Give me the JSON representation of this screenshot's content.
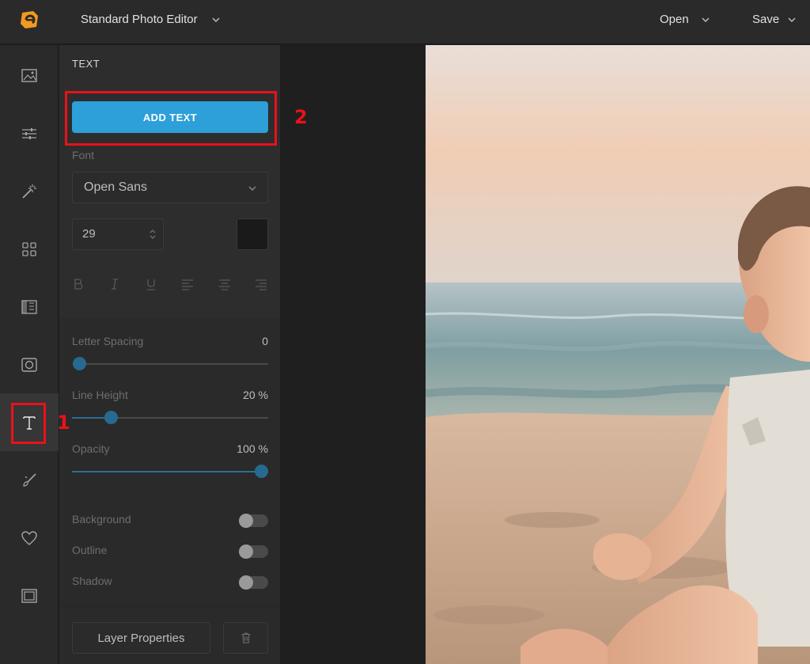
{
  "header": {
    "app_title": "Standard Photo Editor",
    "open_label": "Open",
    "save_label": "Save"
  },
  "rail": {
    "items": [
      "image-icon",
      "adjust-sliders-icon",
      "magic-wand-icon",
      "grid-icon",
      "texture-icon",
      "frame-icon",
      "text-icon",
      "brush-icon",
      "heart-icon",
      "border-icon"
    ],
    "active": "text-icon"
  },
  "annotations": {
    "marker_1": "1",
    "marker_2": "2",
    "color": "#e8121a"
  },
  "panel": {
    "title": "TEXT",
    "add_text_label": "ADD TEXT",
    "font_label": "Font",
    "font_value": "Open Sans",
    "size_value": "29",
    "color_value": "#1a1a1a",
    "format_buttons": [
      "bold-icon",
      "italic-icon",
      "underline-icon",
      "align-left-icon",
      "align-center-icon",
      "align-right-icon"
    ],
    "letter_spacing": {
      "label": "Letter Spacing",
      "value": "0",
      "fraction": 0.0
    },
    "line_height": {
      "label": "Line Height",
      "value": "20 %",
      "fraction": 0.2
    },
    "opacity": {
      "label": "Opacity",
      "value": "100 %",
      "fraction": 1.0
    },
    "toggles": [
      {
        "label": "Background",
        "on": false
      },
      {
        "label": "Outline",
        "on": false
      },
      {
        "label": "Shadow",
        "on": false
      }
    ],
    "layer_properties_label": "Layer Properties"
  },
  "colors": {
    "accent": "#2d9fd9",
    "slider": "#276a91",
    "panel_bg": "#2d2d2d"
  }
}
